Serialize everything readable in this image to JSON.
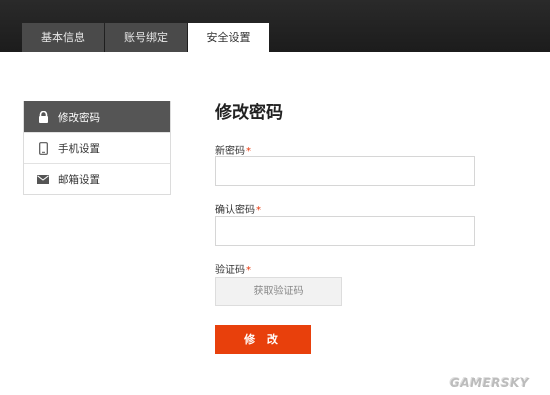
{
  "tabs": [
    {
      "label": "基本信息"
    },
    {
      "label": "账号绑定"
    },
    {
      "label": "安全设置"
    }
  ],
  "sidebar": {
    "items": [
      {
        "label": "修改密码",
        "icon": "lock-icon"
      },
      {
        "label": "手机设置",
        "icon": "phone-icon"
      },
      {
        "label": "邮箱设置",
        "icon": "mail-icon"
      }
    ]
  },
  "form": {
    "title": "修改密码",
    "required_mark": "*",
    "new_password": {
      "label": "新密码",
      "value": "",
      "placeholder": ""
    },
    "confirm_password": {
      "label": "确认密码",
      "value": "",
      "placeholder": ""
    },
    "captcha": {
      "label": "验证码",
      "button": "获取验证码"
    },
    "submit": "修 改"
  },
  "watermark": "GAMERSKY",
  "colors": {
    "accent": "#e8400c",
    "topbar": "#222222",
    "tab_inactive": "#4a4a4a",
    "sidebar_active": "#555555"
  }
}
